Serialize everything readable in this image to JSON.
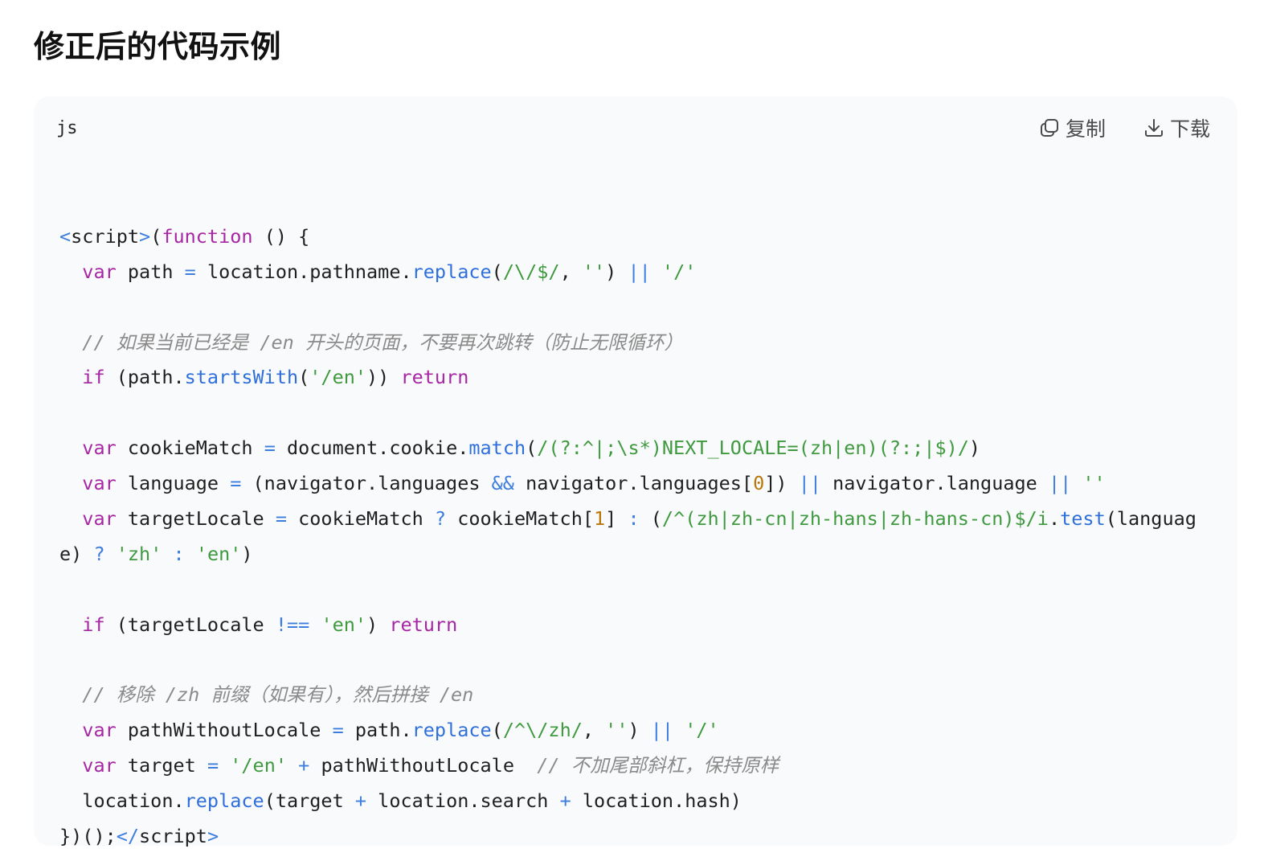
{
  "page": {
    "title": "修正后的代码示例"
  },
  "code_block": {
    "language": "js",
    "copy_label": "复制",
    "download_label": "下载",
    "lines": [
      [],
      [
        [
          "tag",
          "<"
        ],
        [
          "plain",
          "script"
        ],
        [
          "tag",
          ">"
        ],
        [
          "plain",
          "("
        ],
        [
          "kw",
          "function"
        ],
        [
          "plain",
          " () {"
        ]
      ],
      [
        [
          "plain",
          "  "
        ],
        [
          "kw",
          "var"
        ],
        [
          "plain",
          " path "
        ],
        [
          "op",
          "="
        ],
        [
          "plain",
          " location.pathname."
        ],
        [
          "fn",
          "replace"
        ],
        [
          "plain",
          "("
        ],
        [
          "str",
          "/\\/$/"
        ],
        [
          "plain",
          ", "
        ],
        [
          "str",
          "''"
        ],
        [
          "plain",
          ") "
        ],
        [
          "op",
          "||"
        ],
        [
          "plain",
          " "
        ],
        [
          "str",
          "'/'"
        ]
      ],
      [],
      [
        [
          "plain",
          "  "
        ],
        [
          "cm",
          "// 如果当前已经是 /en 开头的页面，不要再次跳转（防止无限循环）"
        ]
      ],
      [
        [
          "plain",
          "  "
        ],
        [
          "kw",
          "if"
        ],
        [
          "plain",
          " (path."
        ],
        [
          "fn",
          "startsWith"
        ],
        [
          "plain",
          "("
        ],
        [
          "str",
          "'/en'"
        ],
        [
          "plain",
          ")) "
        ],
        [
          "kw",
          "return"
        ]
      ],
      [],
      [
        [
          "plain",
          "  "
        ],
        [
          "kw",
          "var"
        ],
        [
          "plain",
          " cookieMatch "
        ],
        [
          "op",
          "="
        ],
        [
          "plain",
          " document.cookie."
        ],
        [
          "fn",
          "match"
        ],
        [
          "plain",
          "("
        ],
        [
          "str",
          "/(?:^|;\\s*)NEXT_LOCALE=(zh|en)(?:;|$)/"
        ],
        [
          "plain",
          ")"
        ]
      ],
      [
        [
          "plain",
          "  "
        ],
        [
          "kw",
          "var"
        ],
        [
          "plain",
          " language "
        ],
        [
          "op",
          "="
        ],
        [
          "plain",
          " (navigator.languages "
        ],
        [
          "op",
          "&&"
        ],
        [
          "plain",
          " navigator.languages["
        ],
        [
          "num",
          "0"
        ],
        [
          "plain",
          "]) "
        ],
        [
          "op",
          "||"
        ],
        [
          "plain",
          " navigator.language "
        ],
        [
          "op",
          "||"
        ],
        [
          "plain",
          " "
        ],
        [
          "str",
          "''"
        ]
      ],
      [
        [
          "plain",
          "  "
        ],
        [
          "kw",
          "var"
        ],
        [
          "plain",
          " targetLocale "
        ],
        [
          "op",
          "="
        ],
        [
          "plain",
          " cookieMatch "
        ],
        [
          "op",
          "?"
        ],
        [
          "plain",
          " cookieMatch["
        ],
        [
          "num",
          "1"
        ],
        [
          "plain",
          "] "
        ],
        [
          "op",
          ":"
        ],
        [
          "plain",
          " ("
        ],
        [
          "str",
          "/^(zh|zh-cn|zh-hans|zh-hans-cn)$/i"
        ],
        [
          "plain",
          "."
        ],
        [
          "fn",
          "test"
        ],
        [
          "plain",
          "(languag"
        ]
      ],
      [
        [
          "plain",
          "e) "
        ],
        [
          "op",
          "?"
        ],
        [
          "plain",
          " "
        ],
        [
          "str",
          "'zh'"
        ],
        [
          "plain",
          " "
        ],
        [
          "op",
          ":"
        ],
        [
          "plain",
          " "
        ],
        [
          "str",
          "'en'"
        ],
        [
          "plain",
          ")"
        ]
      ],
      [],
      [
        [
          "plain",
          "  "
        ],
        [
          "kw",
          "if"
        ],
        [
          "plain",
          " (targetLocale "
        ],
        [
          "op",
          "!=="
        ],
        [
          "plain",
          " "
        ],
        [
          "str",
          "'en'"
        ],
        [
          "plain",
          ") "
        ],
        [
          "kw",
          "return"
        ]
      ],
      [],
      [
        [
          "plain",
          "  "
        ],
        [
          "cm",
          "// 移除 /zh 前缀（如果有），然后拼接 /en"
        ]
      ],
      [
        [
          "plain",
          "  "
        ],
        [
          "kw",
          "var"
        ],
        [
          "plain",
          " pathWithoutLocale "
        ],
        [
          "op",
          "="
        ],
        [
          "plain",
          " path."
        ],
        [
          "fn",
          "replace"
        ],
        [
          "plain",
          "("
        ],
        [
          "str",
          "/^\\/zh/"
        ],
        [
          "plain",
          ", "
        ],
        [
          "str",
          "''"
        ],
        [
          "plain",
          ") "
        ],
        [
          "op",
          "||"
        ],
        [
          "plain",
          " "
        ],
        [
          "str",
          "'/'"
        ]
      ],
      [
        [
          "plain",
          "  "
        ],
        [
          "kw",
          "var"
        ],
        [
          "plain",
          " target "
        ],
        [
          "op",
          "="
        ],
        [
          "plain",
          " "
        ],
        [
          "str",
          "'/en'"
        ],
        [
          "plain",
          " "
        ],
        [
          "op",
          "+"
        ],
        [
          "plain",
          " pathWithoutLocale  "
        ],
        [
          "cm",
          "// 不加尾部斜杠，保持原样"
        ]
      ],
      [
        [
          "plain",
          "  location."
        ],
        [
          "fn",
          "replace"
        ],
        [
          "plain",
          "(target "
        ],
        [
          "op",
          "+"
        ],
        [
          "plain",
          " location.search "
        ],
        [
          "op",
          "+"
        ],
        [
          "plain",
          " location.hash)"
        ]
      ],
      [
        [
          "plain",
          "})();"
        ],
        [
          "tag",
          "</"
        ],
        [
          "plain",
          "script"
        ],
        [
          "tag",
          ">"
        ]
      ]
    ]
  }
}
